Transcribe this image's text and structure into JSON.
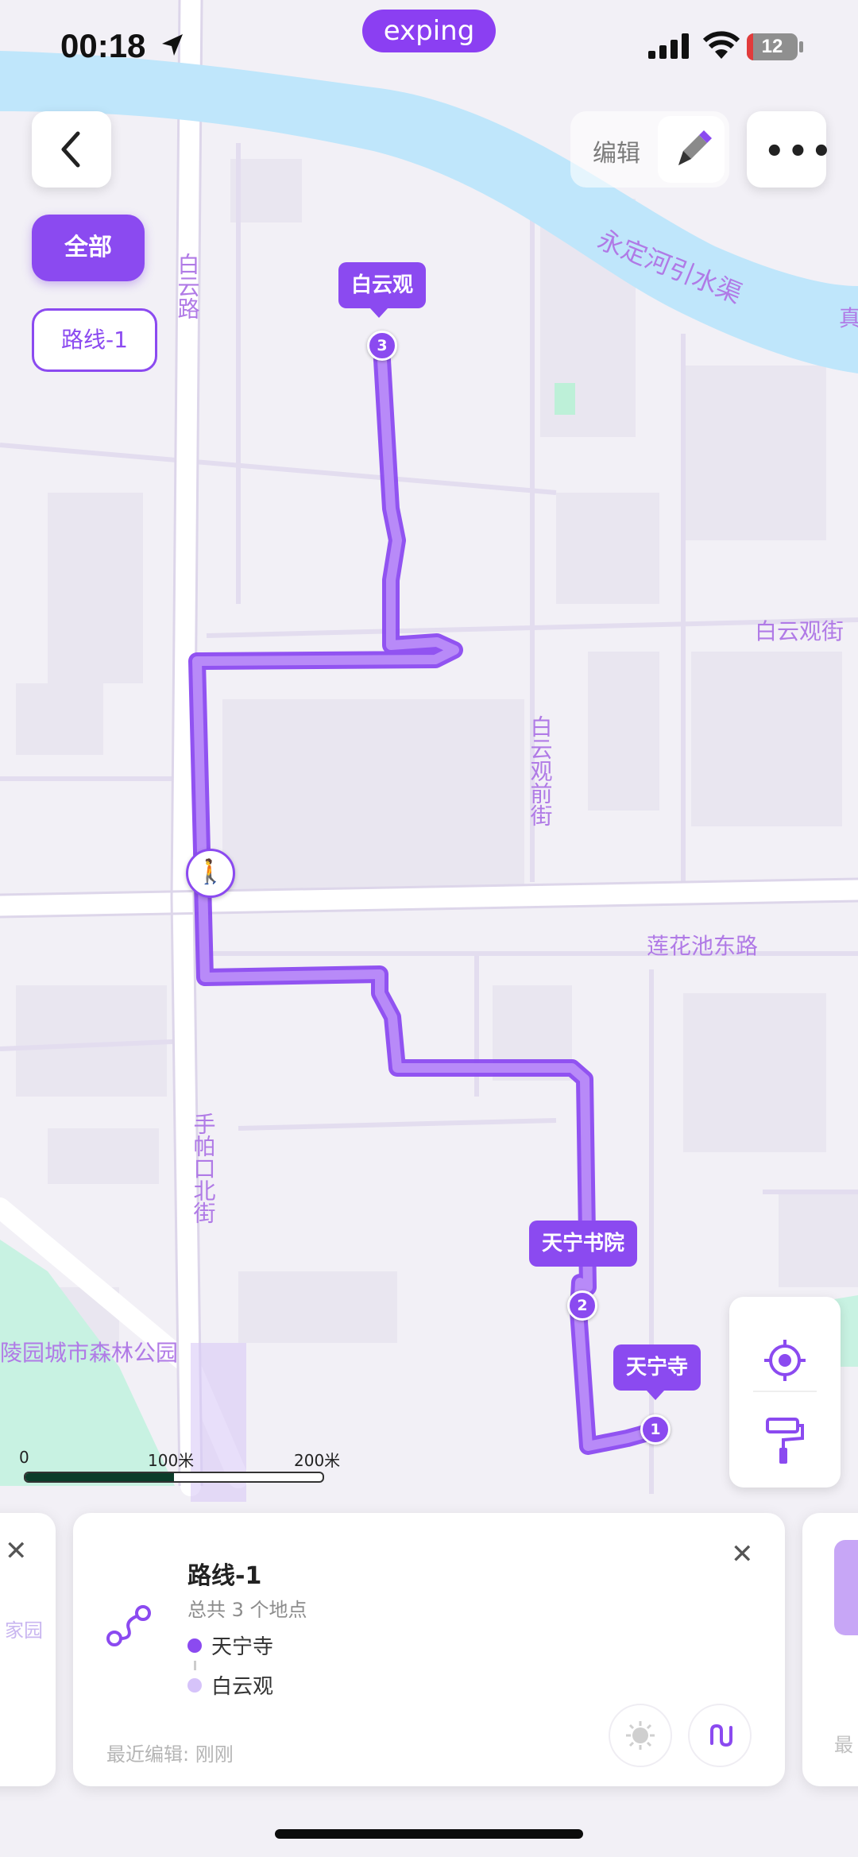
{
  "status_bar": {
    "time": "00:18",
    "battery": "12",
    "brand": "exping"
  },
  "map": {
    "street_labels": [
      "白云路",
      "永定河引水渠",
      "白云观街",
      "白云观前街",
      "莲花池东路",
      "手帕口北街",
      "陵园城市森林公园",
      "真"
    ],
    "scale": {
      "zero": "0",
      "mid": "100米",
      "end": "200米"
    },
    "stops": [
      {
        "num": "1",
        "name": "天宁寺"
      },
      {
        "num": "2",
        "name": "天宁书院"
      },
      {
        "num": "3",
        "name": "白云观"
      }
    ]
  },
  "top": {
    "edit_label": "编辑",
    "more": "•••"
  },
  "filters": {
    "all": "全部",
    "route": "路线-1"
  },
  "route_card": {
    "title": "路线-1",
    "subtitle": "总共 3 个地点",
    "stops": [
      "天宁寺",
      "白云观"
    ],
    "recent": "最近编辑: 刚刚"
  },
  "side_cards": {
    "left_fragment": "家园",
    "right_fragment": "最"
  },
  "colors": {
    "accent": "#8b4af0",
    "route": "#9b5cf5",
    "water": "#bfe6fb",
    "park": "#c8f2e2"
  }
}
